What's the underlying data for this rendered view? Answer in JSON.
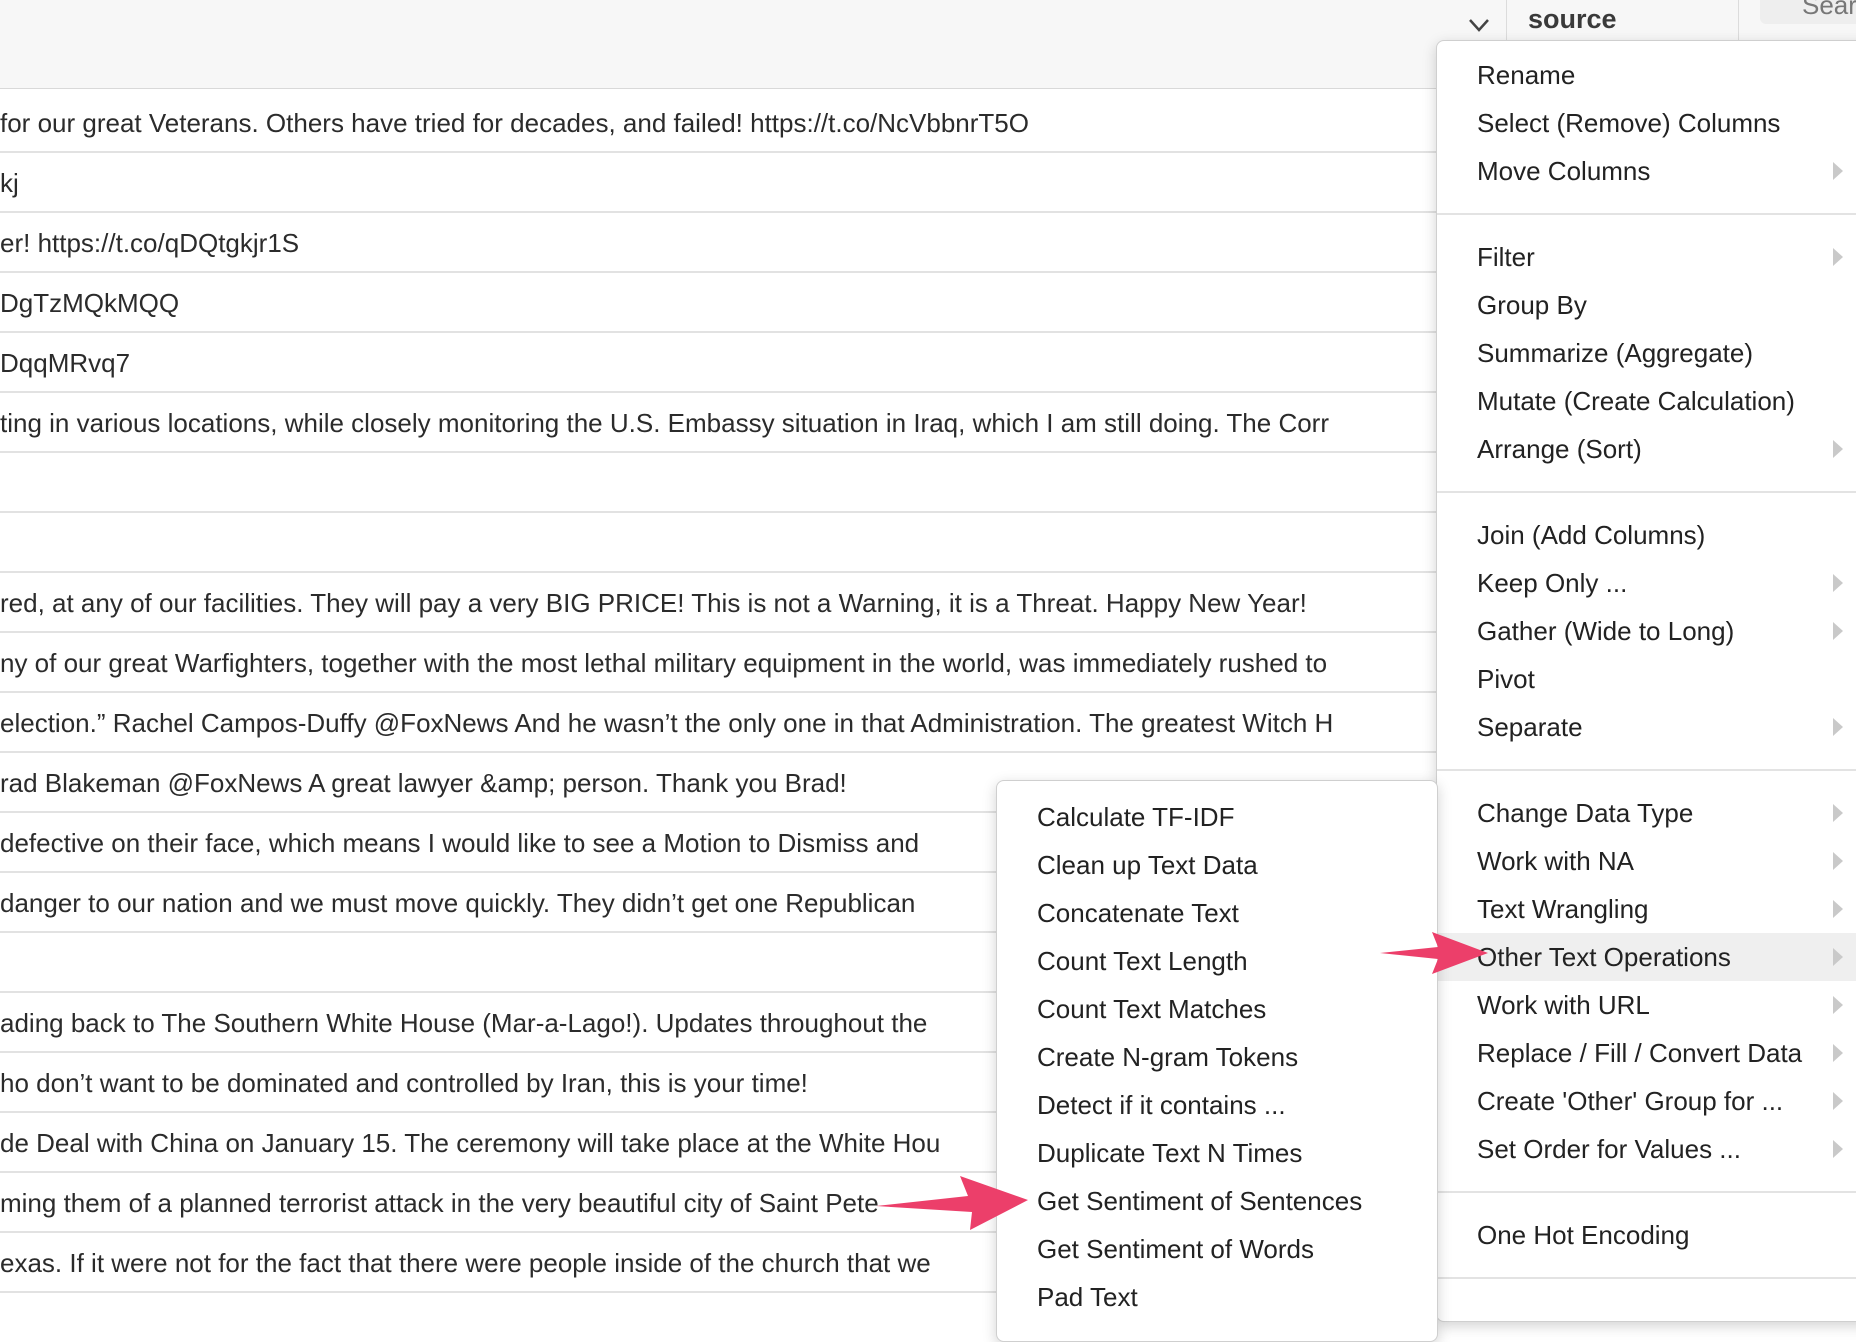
{
  "header": {
    "column_label": "source",
    "search_label": "Sear"
  },
  "rows": [
    " for our great Veterans. Others have tried for decades, and failed! https://t.co/NcVbbnrT5O",
    "kj",
    "er! https://t.co/qDQtgkjr1S",
    "DgTzMQkMQQ",
    "DqqMRvq7",
    "ting in various locations, while closely monitoring the U.S. Embassy situation in Iraq, which I am still doing. The Corr",
    "",
    "",
    "red, at any of our facilities. They will pay a very BIG PRICE! This is not a Warning, it is a Threat. Happy New Year!",
    "ny of our great Warfighters, together with the most lethal military equipment in the world, was immediately rushed to",
    "election.” Rachel Campos-Duffy  @FoxNews  And he wasn’t the only one in that Administration. The greatest Witch H",
    "rad Blakeman @FoxNews  A great lawyer &amp; person. Thank you Brad!",
    "defective on their face, which means I would like to see a Motion to Dismiss and",
    "danger to our nation and we must move quickly. They didn’t get one Republican",
    "",
    "ading back to The Southern White House (Mar-a-Lago!). Updates throughout the",
    "ho don’t want to be dominated and controlled by Iran, this is your time!",
    "de Deal with China on January 15. The ceremony will take place at the White Hou",
    "ming them of a planned terrorist attack in the very beautiful city of Saint Pete",
    "exas. If it were not for the fact that there were people inside of the church that we"
  ],
  "main_menu": {
    "items": [
      {
        "label": "Rename",
        "submenu": false
      },
      {
        "label": "Select (Remove) Columns",
        "submenu": false
      },
      {
        "label": "Move Columns",
        "submenu": true
      },
      {
        "label": "Filter",
        "submenu": true
      },
      {
        "label": "Group By",
        "submenu": false
      },
      {
        "label": "Summarize (Aggregate)",
        "submenu": false
      },
      {
        "label": "Mutate (Create Calculation)",
        "submenu": false
      },
      {
        "label": "Arrange (Sort)",
        "submenu": true
      },
      {
        "label": "Join (Add Columns)",
        "submenu": false
      },
      {
        "label": "Keep Only ...",
        "submenu": true
      },
      {
        "label": "Gather (Wide to Long)",
        "submenu": true
      },
      {
        "label": "Pivot",
        "submenu": false
      },
      {
        "label": "Separate",
        "submenu": true
      },
      {
        "label": "Change Data Type",
        "submenu": true
      },
      {
        "label": "Work with NA",
        "submenu": true
      },
      {
        "label": "Text Wrangling",
        "submenu": true
      },
      {
        "label": "Other Text Operations",
        "submenu": true,
        "active": true
      },
      {
        "label": "Work with URL",
        "submenu": true
      },
      {
        "label": "Replace / Fill / Convert Data",
        "submenu": true
      },
      {
        "label": "Create 'Other' Group for ...",
        "submenu": true
      },
      {
        "label": "Set Order for Values ...",
        "submenu": true
      },
      {
        "label": "One Hot Encoding",
        "submenu": false
      }
    ]
  },
  "sub_menu": {
    "items": [
      "Calculate TF-IDF",
      "Clean up Text Data",
      "Concatenate Text",
      "Count Text Length",
      "Count Text Matches",
      "Create N-gram Tokens",
      "Detect if it contains ...",
      "Duplicate Text N Times",
      "Get Sentiment of Sentences",
      "Get Sentiment of Words",
      "Pad Text"
    ]
  },
  "annotation_color": "#ec3f6a"
}
